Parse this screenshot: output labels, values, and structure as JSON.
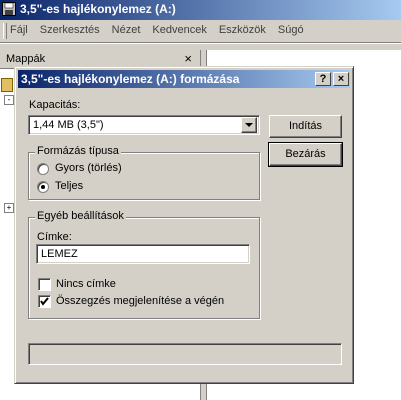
{
  "window": {
    "title": "3,5\"-es hajlékonylemez (A:)",
    "menu": [
      "Fájl",
      "Szerkesztés",
      "Nézet",
      "Kedvencek",
      "Eszközök",
      "Súgó"
    ]
  },
  "folders_pane": {
    "title": "Mappák",
    "close": "×"
  },
  "dialog": {
    "title": "3,5\"-es hajlékonylemez (A:) formázása",
    "help_button": "?",
    "close_button": "×",
    "capacity_label": "Kapacitás:",
    "capacity_value": "1,44 MB (3,5\")",
    "start_button": "Indítás",
    "close_dialog_button": "Bezárás",
    "format_type": {
      "legend": "Formázás típusa",
      "options": [
        {
          "label": "Gyors (törlés)",
          "selected": false
        },
        {
          "label": "Teljes",
          "selected": true
        }
      ]
    },
    "other_settings": {
      "legend": "Egyéb beállítások",
      "label_caption": "Címke:",
      "label_value": "LEMEZ",
      "no_label": {
        "label": "Nincs címke",
        "checked": false
      },
      "show_summary": {
        "label": "Összegzés megjelenítése a végén",
        "checked": true
      }
    },
    "status_text": ""
  }
}
